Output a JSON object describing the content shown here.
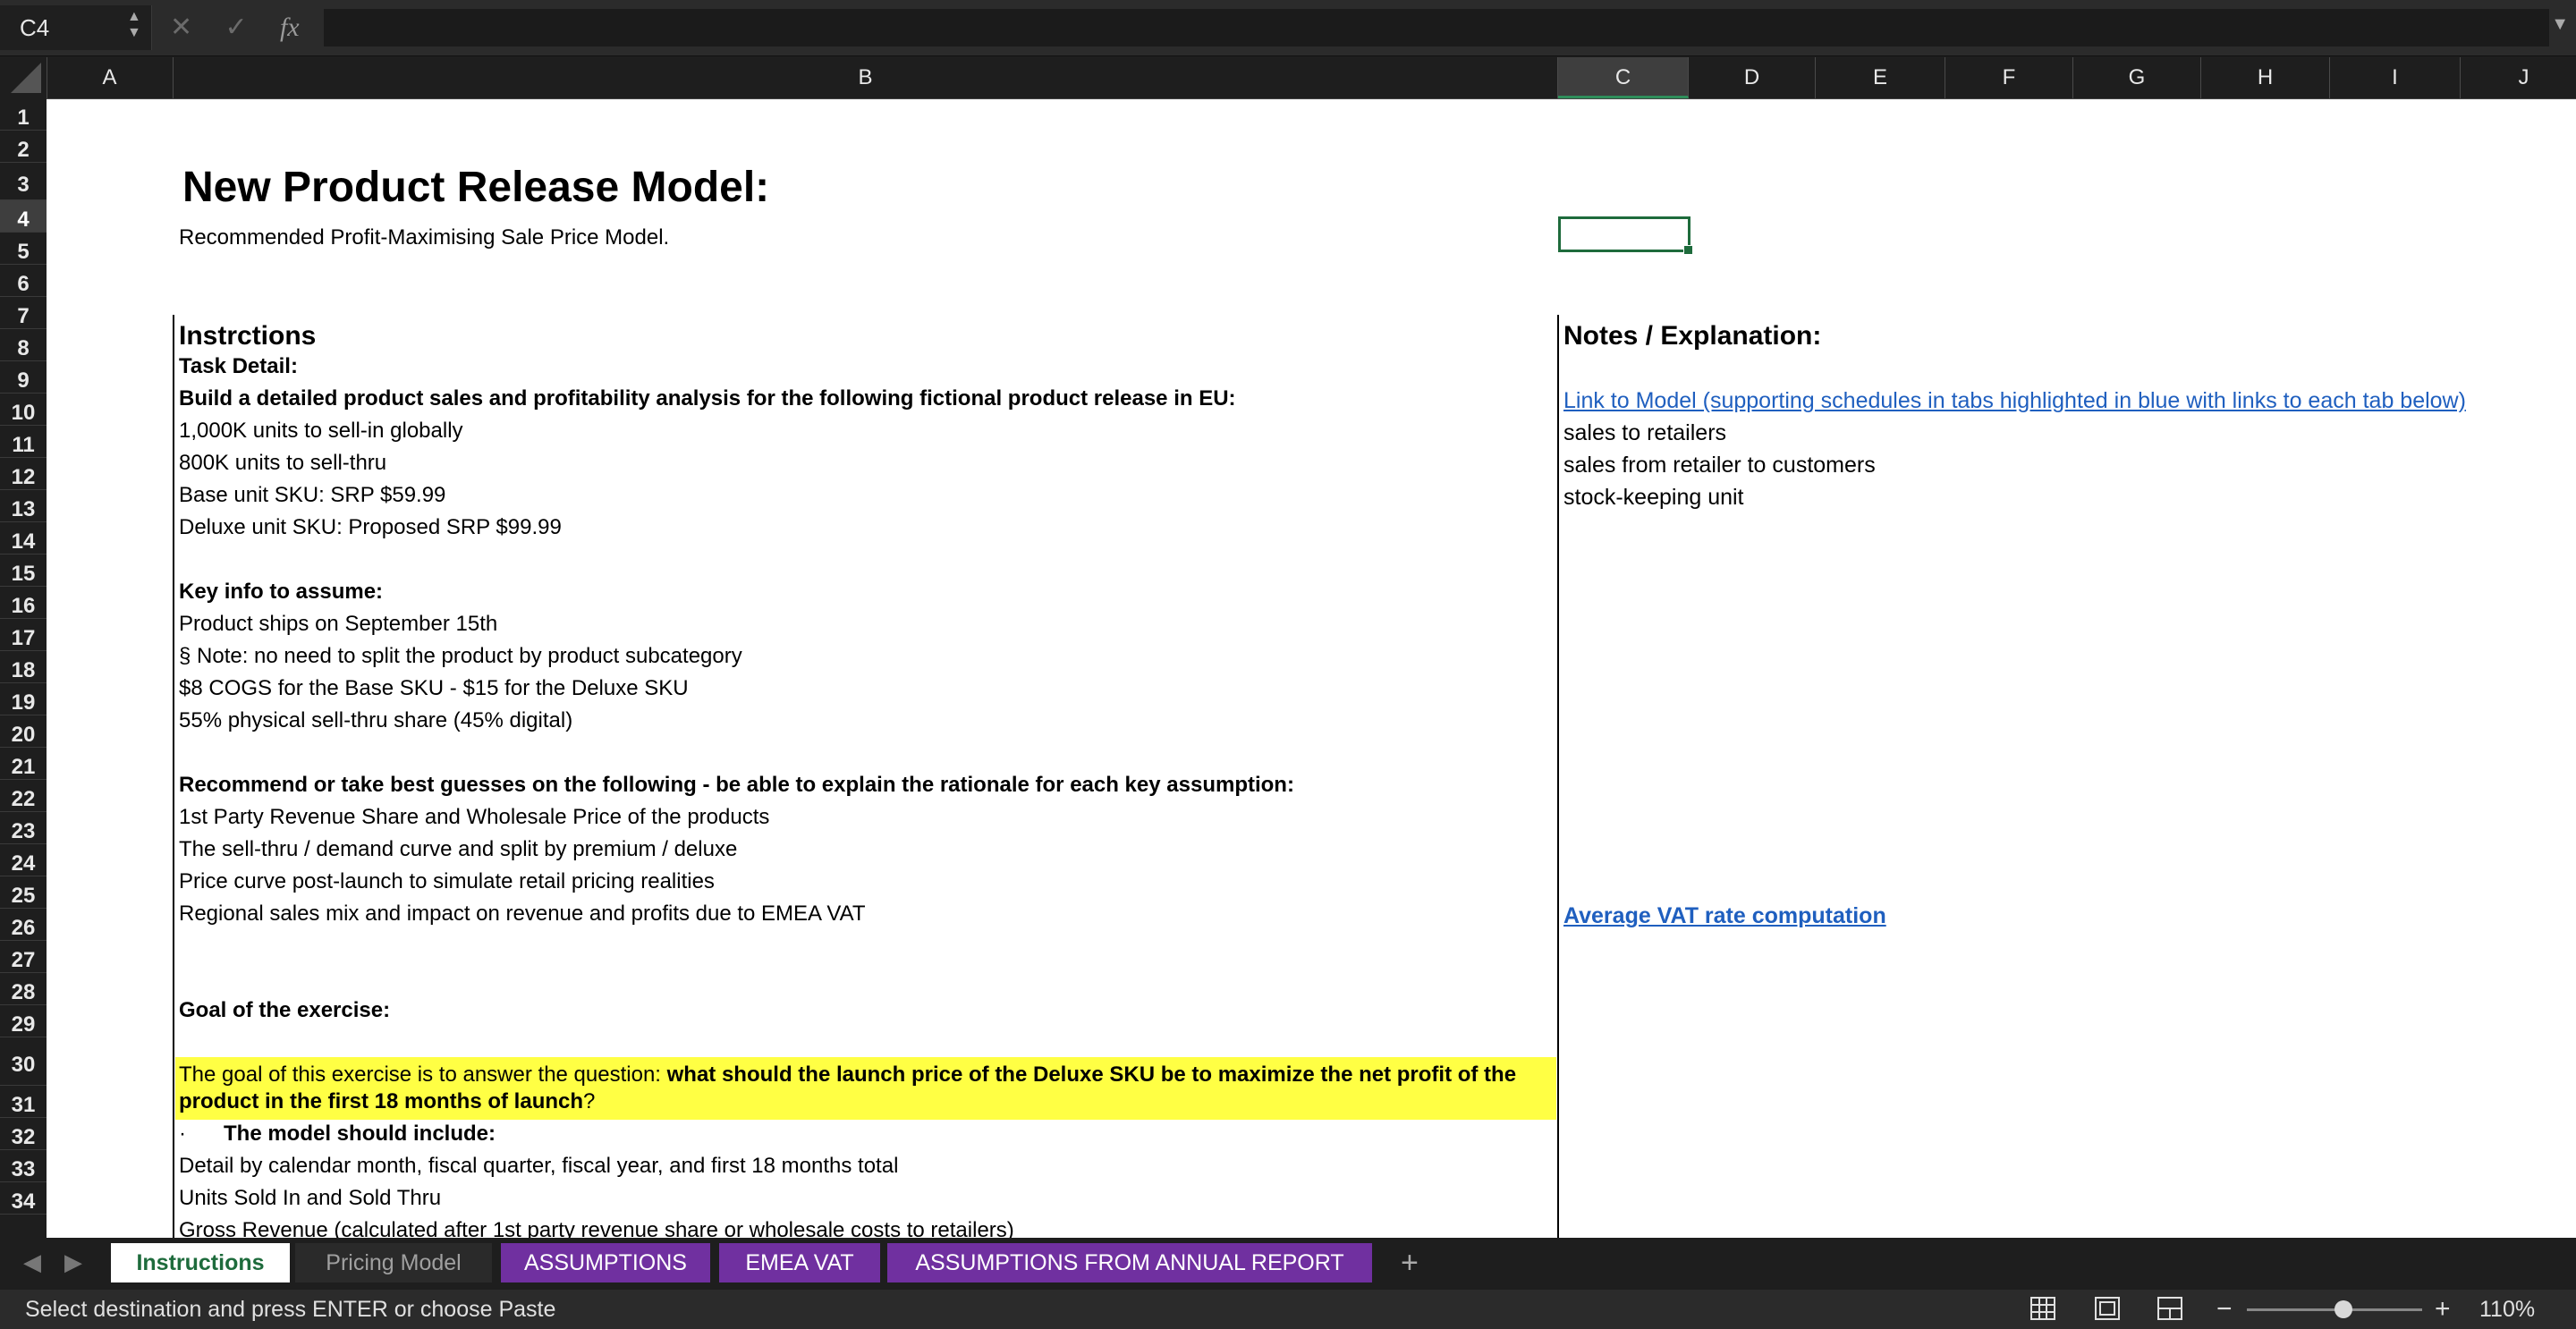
{
  "formula_bar": {
    "name_box": "C4",
    "formula": "",
    "fx_label": "fx"
  },
  "columns": [
    "A",
    "B",
    "C",
    "D",
    "E",
    "F",
    "G",
    "H",
    "I",
    "J"
  ],
  "rows": [
    "1",
    "2",
    "3",
    "4",
    "5",
    "6",
    "7",
    "8",
    "9",
    "10",
    "11",
    "12",
    "13",
    "14",
    "15",
    "16",
    "17",
    "18",
    "19",
    "20",
    "21",
    "22",
    "23",
    "24",
    "25",
    "26",
    "27",
    "28",
    "29",
    "30",
    "31",
    "32",
    "33",
    "34"
  ],
  "selected_cell": {
    "column": "C",
    "row": "4"
  },
  "sheet": {
    "title": "New Product Release Model:",
    "subtitle": "Recommended Profit-Maximising Sale Price Model.",
    "instructions_heading": "Instrctions",
    "task_detail": "Task Detail:",
    "build_line": "Build a detailed product sales and profitability analysis for the following fictional product release in EU:",
    "b10": "1,000K units to sell-in globally",
    "b11": "800K units to sell-thru",
    "b12": "Base unit SKU: SRP $59.99",
    "b13": "Deluxe unit SKU: Proposed SRP $99.99",
    "key_info": "Key info to assume:",
    "b16": "Product ships on September 15th",
    "b17": "§  Note: no need to split the product by product subcategory",
    "b18": "$8 COGS for the Base SKU - $15 for the Deluxe SKU",
    "b19": "55% physical sell-thru share (45% digital)",
    "recommend": "Recommend or take best guesses on the following - be able to explain the rationale for each key assumption:",
    "b22": "1st Party Revenue Share and Wholesale Price of the products",
    "b23": "The sell-thru / demand curve and split by premium / deluxe",
    "b24": "Price curve post-launch to simulate retail pricing realities",
    "b25": "Regional sales mix and impact on revenue and profits due to EMEA VAT",
    "goal_heading": "Goal of the exercise:",
    "goal_prefix": "The goal of this exercise is to answer the question: ",
    "goal_bold_1": "what should the launch price of the Deluxe SKU be to maximize the net profit of the",
    "goal_bold_2": "product in the first 18 months of launch",
    "goal_end": "?",
    "b31_bullet": "·",
    "b31": "The model should include:",
    "b32": "Detail by calendar month, fiscal quarter, fiscal year, and first 18 months total",
    "b33": "Units Sold In and Sold Thru",
    "b34": "Gross Revenue (calculated after 1st party revenue share or wholesale costs to retailers)",
    "notes_heading": "Notes / Explanation:",
    "c9_link": "Link to Model (supporting schedules in tabs highlighted in blue with links to each tab below)",
    "c10": "sales to retailers",
    "c11": "sales from retailer to customers",
    "c12": "stock-keeping unit",
    "c25_link": "Average VAT rate computation"
  },
  "tabs": [
    {
      "label": "Instructions",
      "state": "active"
    },
    {
      "label": "Pricing Model",
      "state": "normal"
    },
    {
      "label": "ASSUMPTIONS",
      "state": "purple"
    },
    {
      "label": "EMEA VAT",
      "state": "purple"
    },
    {
      "label": "ASSUMPTIONS FROM ANNUAL REPORT",
      "state": "purple"
    }
  ],
  "tab_add": "+",
  "status": {
    "message": "Select destination and press ENTER or choose Paste",
    "zoom": "110%",
    "zoom_level": 0.55
  },
  "colors": {
    "accent_green": "#1e6b3c",
    "tab_purple": "#7030a0",
    "highlight_yellow": "#ffff44",
    "link_blue": "#1f5fbf"
  }
}
